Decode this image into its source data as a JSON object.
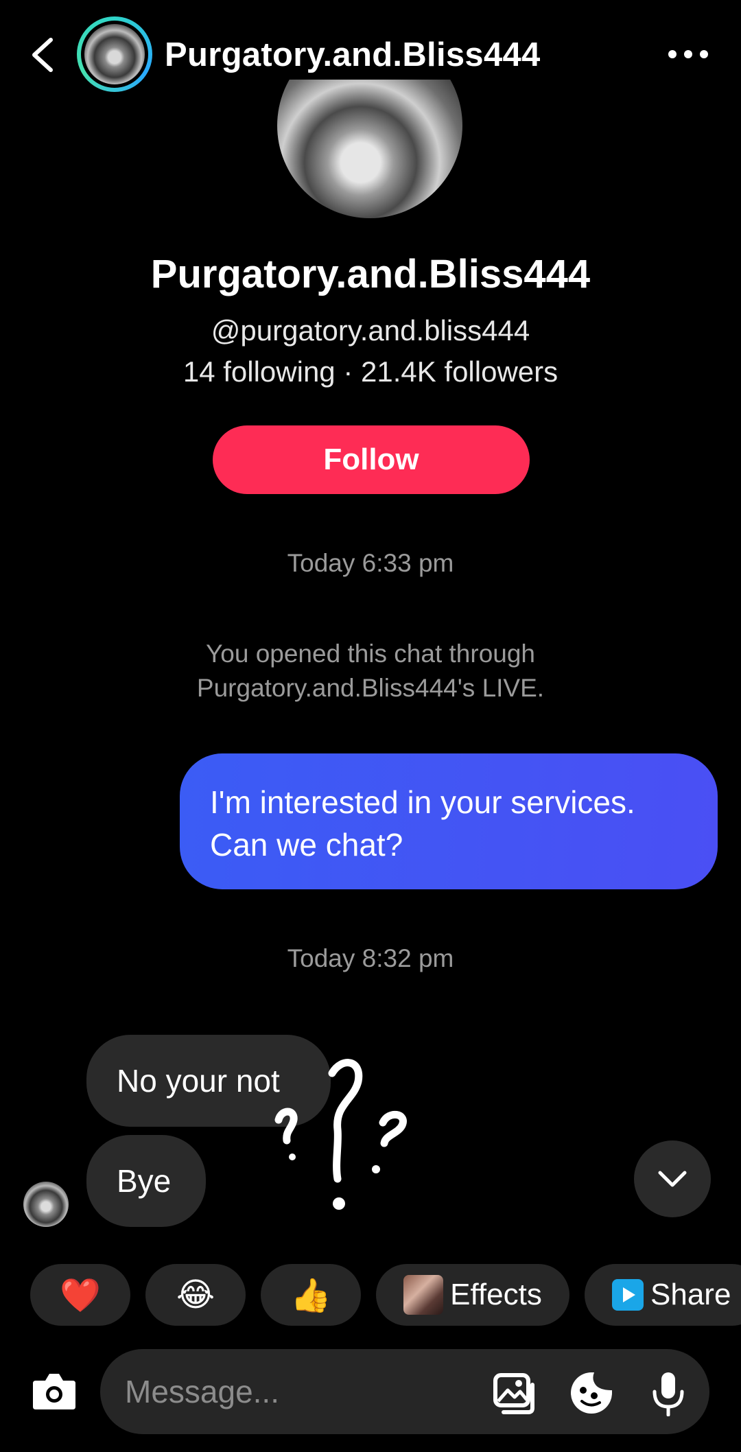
{
  "header": {
    "title": "Purgatory.and.Bliss444",
    "back_icon": "chevron-left-icon",
    "more_icon": "more-horizontal-icon"
  },
  "profile": {
    "display_name": "Purgatory.and.Bliss444",
    "handle": "@purgatory.and.bliss444",
    "stats": "14 following · 21.4K followers",
    "follow_label": "Follow"
  },
  "chat": {
    "timestamp_1": "Today 6:33 pm",
    "system_note_line1": "You opened this chat through",
    "system_note_line2": "Purgatory.and.Bliss444's LIVE.",
    "outgoing_line1": "I'm interested in your services.",
    "outgoing_line2": "Can we chat?",
    "timestamp_2": "Today 8:32 pm",
    "incoming": [
      "No your not",
      "Bye"
    ]
  },
  "quick_reactions": {
    "heart": "❤️",
    "laugh": "😂",
    "thumbs_up": "👍",
    "effects_label": "Effects",
    "share_label": "Share"
  },
  "composer": {
    "placeholder": "Message..."
  },
  "colors": {
    "follow": "#fe2c55",
    "outgoing_bubble": "#3f55f5",
    "incoming_bubble": "#2a2a2a"
  }
}
